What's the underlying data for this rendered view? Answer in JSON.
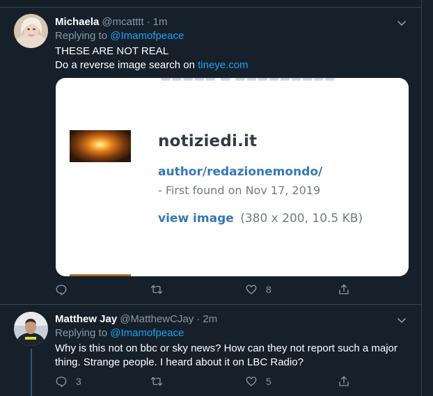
{
  "tweets": [
    {
      "display_name": "Michaela",
      "handle": "@mcatttt",
      "separator": "·",
      "time": "1m",
      "replying_prefix": "Replying to",
      "replying_to": "@Imamofpeace",
      "text_line1": "THESE ARE NOT REAL",
      "text_line2_prefix": "Do a reverse image search on",
      "link_text": "tineye.com",
      "card": {
        "site": "notiziedi.it",
        "author_path": "author/redazionemondo/",
        "first_found": "- First found on Nov 17, 2019",
        "view_image": "view image",
        "dimensions": "(380 x 200, 10.5 KB)"
      },
      "actions": {
        "reply_count": "",
        "retweet_count": "",
        "like_count": "8"
      }
    },
    {
      "display_name": "Matthew Jay",
      "handle": "@MatthewCJay",
      "separator": "·",
      "time": "2m",
      "replying_prefix": "Replying to",
      "replying_to": "@Imamofpeace",
      "text": "Why is this not on bbc or sky news? How can they not report such a major thing. Strange people. I heard about it on LBC Radio?",
      "actions": {
        "reply_count": "3",
        "retweet_count": "",
        "like_count": "5"
      }
    }
  ],
  "colors": {
    "background": "#15202b",
    "divider": "#38444d",
    "accent": "#1da1f2",
    "secondary_text": "#8899a6",
    "card_link": "#3677b6"
  },
  "icons": {
    "reply": "reply-icon",
    "retweet": "retweet-icon",
    "like": "heart-icon",
    "share": "share-icon",
    "more": "chevron-down-icon"
  }
}
